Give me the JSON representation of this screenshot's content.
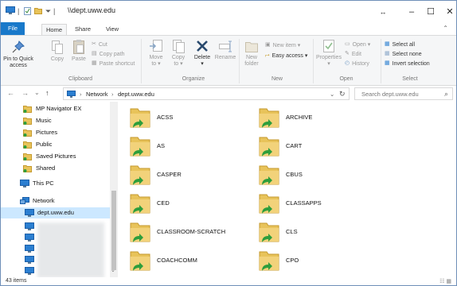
{
  "window": {
    "title": "\\\\dept.uww.edu",
    "minimize": "–",
    "maximize": "☐",
    "close": "✕",
    "restore_icon": "↔"
  },
  "ribbon_tabs": [
    "File",
    "Home",
    "Share",
    "View"
  ],
  "ribbon_expand": "⌃",
  "ribbon": {
    "clipboard": {
      "label": "Clipboard",
      "pin_to_quick": "Pin to Quick",
      "access": "access",
      "copy": "Copy",
      "paste": "Paste",
      "cut": "Cut",
      "copy_path": "Copy path",
      "paste_shortcut": "Paste shortcut"
    },
    "organize": {
      "label": "Organize",
      "move": "Move",
      "move_to": "to",
      "copy": "Copy",
      "copy_to": "to",
      "delete": "Delete",
      "rename": "Rename"
    },
    "new": {
      "label": "New",
      "new_folder_line1": "New",
      "new_folder_line2": "folder",
      "new_item": "New item",
      "easy_access": "Easy access"
    },
    "open": {
      "label": "Open",
      "properties": "Properties",
      "open": "Open",
      "edit": "Edit",
      "history": "History"
    },
    "select": {
      "label": "Select",
      "select_all": "Select all",
      "select_none": "Select none",
      "invert_selection": "Invert selection"
    }
  },
  "address": {
    "back": "←",
    "forward": "→",
    "recent": "⌄",
    "up": "↑",
    "crumb_sep": "›",
    "crumbs": [
      "Network",
      "dept.uww.edu"
    ],
    "dropdown": "⌄",
    "refresh": "↻",
    "search_placeholder": "Search dept.uww.edu",
    "search_icon": "⌕"
  },
  "nav_pane": {
    "items": [
      {
        "label": "MP Navigator EX",
        "icon": "folder-icon"
      },
      {
        "label": "Music",
        "icon": "folder-icon"
      },
      {
        "label": "Pictures",
        "icon": "folder-icon"
      },
      {
        "label": "Public",
        "icon": "folder-icon"
      },
      {
        "label": "Saved Pictures",
        "icon": "folder-icon"
      },
      {
        "label": "Shared",
        "icon": "folder-icon"
      },
      {
        "label": "This PC",
        "icon": "computer-icon"
      },
      {
        "label": "Network",
        "icon": "network-icon"
      },
      {
        "label": "dept.uww.edu",
        "icon": "network-drive-icon"
      }
    ]
  },
  "folders": {
    "left": [
      "ACSS",
      "AS",
      "CASPER",
      "CED",
      "CLASSROOM-SCRATCH",
      "COACHCOMM"
    ],
    "right": [
      "ARCHIVE",
      "CART",
      "CBUS",
      "CLASSAPPS",
      "CLS",
      "CPO"
    ]
  },
  "status": {
    "count": "43 items",
    "views": "☷ ▦"
  },
  "colors": {
    "accent": "#1979ca",
    "selection": "#cce8ff",
    "folder": "#e8c35a",
    "share_link": "#2e9e3c"
  }
}
